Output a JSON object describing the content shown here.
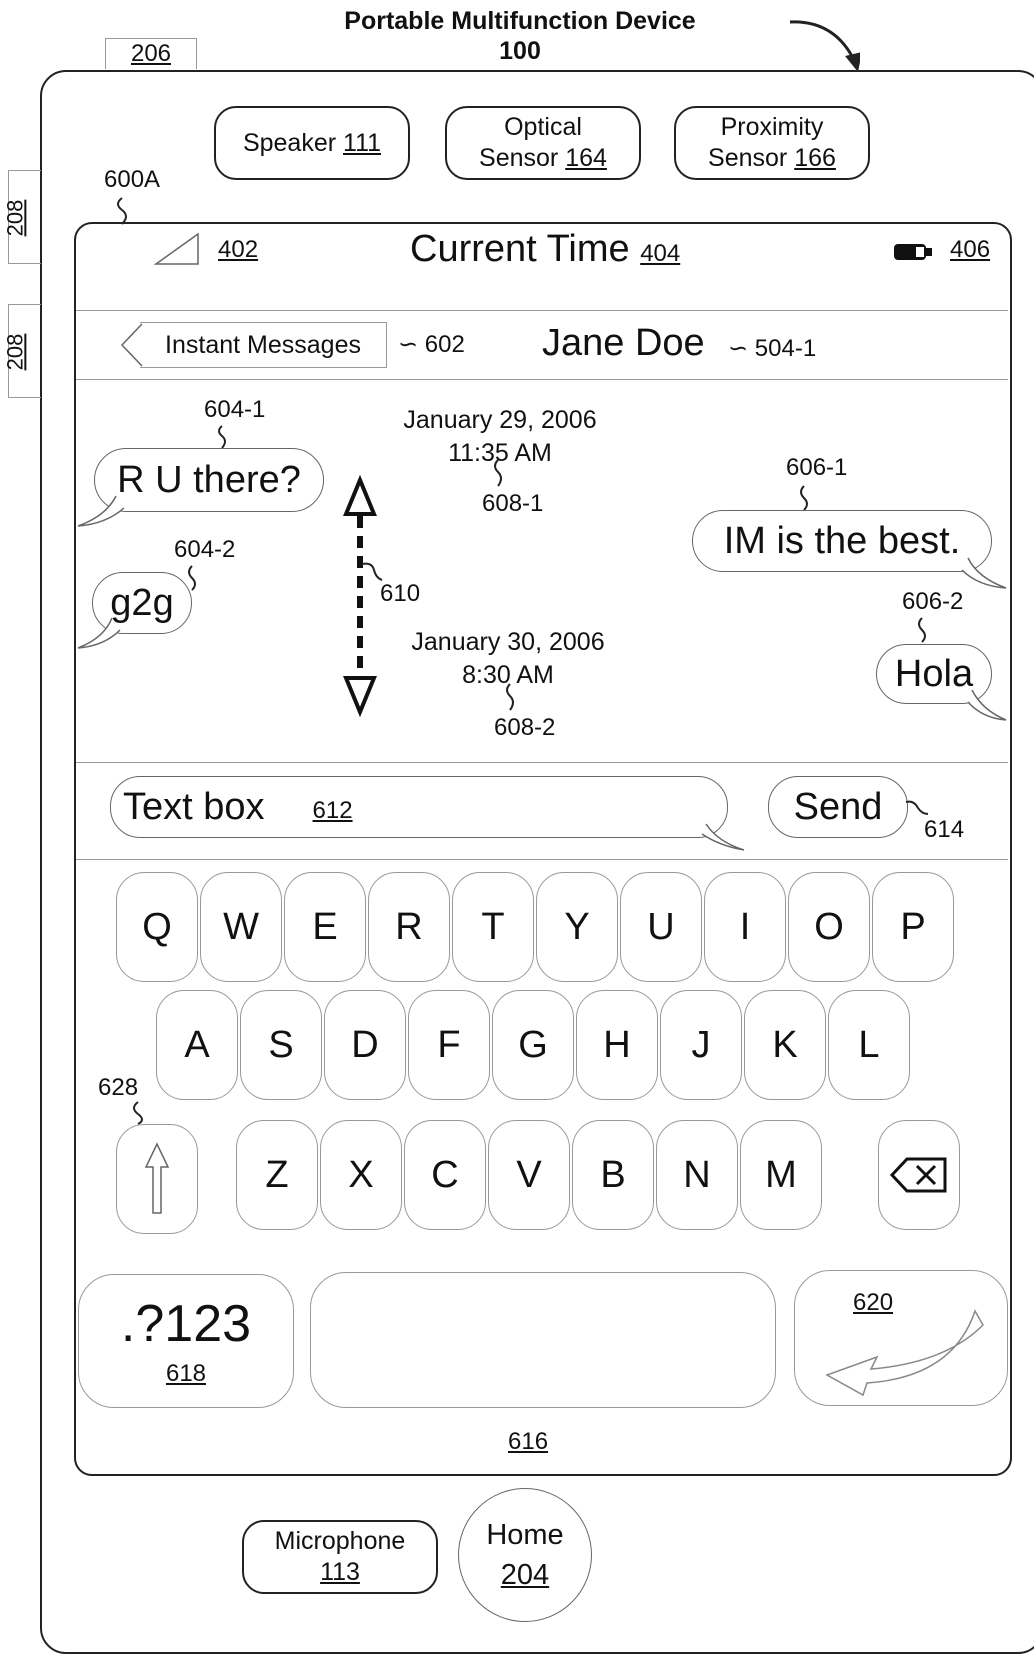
{
  "header": {
    "title": "Portable Multifunction Device",
    "number": "100"
  },
  "device_refs": {
    "top_button": "206",
    "side_button_1": "208",
    "side_button_2": "208",
    "screen_ref": "600A"
  },
  "sensors": [
    {
      "label": "Speaker",
      "ref": "111"
    },
    {
      "label": "Optical",
      "label2": "Sensor",
      "ref": "164"
    },
    {
      "label": "Proximity",
      "label2": "Sensor",
      "ref": "166"
    }
  ],
  "status_bar": {
    "signal_ref": "402",
    "time_label": "Current Time",
    "time_ref": "404",
    "battery_ref": "406"
  },
  "nav": {
    "back_label": "Instant Messages",
    "back_ref": "602",
    "contact_name": "Jane Doe",
    "contact_ref": "504-1"
  },
  "messages": {
    "received": [
      {
        "text": "R U there?",
        "ref": "604-1"
      },
      {
        "text": "g2g",
        "ref": "604-2"
      }
    ],
    "sent": [
      {
        "text": "IM is the best.",
        "ref": "606-1"
      },
      {
        "text": "Hola",
        "ref": "606-2"
      }
    ],
    "timestamps": [
      {
        "date": "January 29, 2006",
        "time": "11:35 AM",
        "ref": "608-1"
      },
      {
        "date": "January 30, 2006",
        "time": "8:30 AM",
        "ref": "608-2"
      }
    ],
    "scroll_ref": "610"
  },
  "compose": {
    "text_box_label": "Text box",
    "text_box_ref": "612",
    "send_label": "Send",
    "send_ref": "614"
  },
  "keyboard": {
    "row1": [
      "Q",
      "W",
      "E",
      "R",
      "T",
      "Y",
      "U",
      "I",
      "O",
      "P"
    ],
    "row2": [
      "A",
      "S",
      "D",
      "F",
      "G",
      "H",
      "J",
      "K",
      "L"
    ],
    "row3": [
      "Z",
      "X",
      "C",
      "V",
      "B",
      "N",
      "M"
    ],
    "shift_ref": "628",
    "numbers_label": ".?123",
    "numbers_ref": "618",
    "return_ref": "620",
    "keyboard_ref": "616"
  },
  "bottom": {
    "microphone_label": "Microphone",
    "microphone_ref": "113",
    "home_label": "Home",
    "home_ref": "204"
  }
}
